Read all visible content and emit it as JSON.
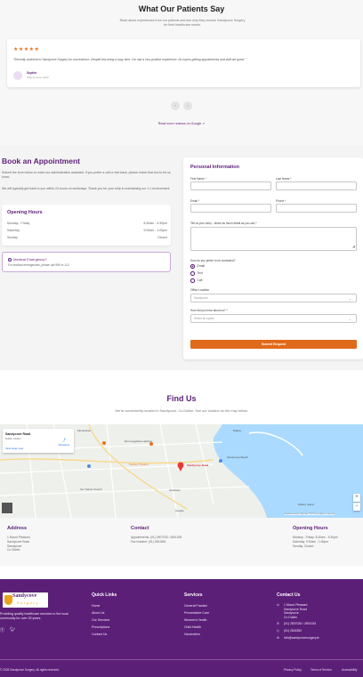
{
  "testimonials": {
    "title": "What Our Patients Say",
    "subtitle_l1": "Read about experiences from our patients and see why they choose Sandycove Surgery",
    "subtitle_l2": "for their healthcare needs.",
    "rating": "★★★★★",
    "quote": "\"Recently switched to Sandycove Surgery for convenience. Despite this being a busy time, I've had a very positive experience. No issues getting appointments and staff are great.\"",
    "name": "Sophie",
    "since": "Patient since 2022",
    "prev": "‹",
    "next": "›",
    "read_more": "Read more reviews on Google ↗"
  },
  "appointment": {
    "title": "Book an Appointment",
    "p1": "Submit the form below to reach our administrative assistant. If you prefer a call or text back, please check that box to let us know.",
    "p2": "We will typically get back to you within 24 hours on weekdays. Thank you for your help in maintaining our 1:1 environment.",
    "hours_title": "Opening Hours",
    "hours": [
      {
        "day": "Monday - Friday",
        "time": "8:30am - 5:30pm"
      },
      {
        "day": "Saturday",
        "time": "9:00am - 1:00pm"
      },
      {
        "day": "Sunday",
        "time": "Closed"
      }
    ],
    "emergency_title": "Medical Emergency?",
    "emergency_text": "For medical emergencies, please call 999 or 112."
  },
  "form": {
    "title": "Personal Information",
    "first_name": "First Name *",
    "last_name": "Last Name *",
    "email": "Email *",
    "phone": "Phone *",
    "story": "Tell us your story - share as much detail as you can *",
    "contact_q": "How do you prefer to be contacted?",
    "contact_options": [
      "Email",
      "Text",
      "Call"
    ],
    "location_label": "Office Location",
    "location_value": "Sandycove",
    "heard_label": "How did you hear about us? *",
    "heard_value": "Select an option",
    "submit": "Submit Request"
  },
  "find": {
    "title": "Find Us",
    "subtitle": "We're conveniently located in Sandycove, Co Dublin. See our location on the map below.",
    "card_name": "Sandycove Road",
    "card_addr": "Dublin, Dublin",
    "card_link": "View larger map",
    "directions": "Directions",
    "pin_label": "Sandycove Road",
    "labels": {
      "monkstown": "Monkstown",
      "harbour": "Dún Laoghaire Harbour",
      "glasthule": "Glasthule",
      "dalkey": "Dalkey",
      "sandycove_beach": "Sandycove Beach",
      "pavilion": "Pavilion Theatre",
      "saints": "Our Saints Church",
      "patricks": "Dalkey Island",
      "google": "Google",
      "attribution": "Keyboard shortcuts   Map data ©2025   Terms   Report a map error"
    }
  },
  "contactbar": {
    "address_title": "Address",
    "address": [
      "1 Mount Pleasant",
      "Sandycove Road",
      "Sandycove",
      "Co Dublin"
    ],
    "contact_title": "Contact",
    "contact": [
      "Appointments: (01) 2807026 / 2801025",
      "Fax Number: (01) 2841852"
    ],
    "hours_title": "Opening Hours",
    "hours": [
      "Monday - Friday: 8:30am - 5:30pm",
      "Saturday: 9:00am - 1:00pm",
      "Sunday: Closed"
    ]
  },
  "footer": {
    "logo_top": "Sandycove",
    "logo_bottom": "Surgery",
    "tagline": "Providing quality healthcare services to the local community for over 25 years.",
    "quick_title": "Quick Links",
    "quick": [
      "Home",
      "About Us",
      "Our Services",
      "Prescriptions",
      "Contact Us"
    ],
    "services_title": "Services",
    "services": [
      "General Practice",
      "Preventative Care",
      "Women's Health",
      "Child Health",
      "Vaccination"
    ],
    "contact_title": "Contact Us",
    "contact_addr": [
      "1 Mount Pleasant",
      "Sandycove Road",
      "Sandycove",
      "Co Dublin"
    ],
    "contact_phone": "(01) 2807026 / 2801025",
    "contact_fax": "(01) 2841852",
    "contact_email": "info@sandycovesurgery.ie",
    "copyright": "© 2025 Sandycove Surgery. All rights reserved.",
    "legal": [
      "Privacy Policy",
      "Terms of Service",
      "Accessibility"
    ]
  },
  "colors": {
    "brand": "#5c1f78",
    "accent": "#e06a1b",
    "star": "#e8731f"
  }
}
